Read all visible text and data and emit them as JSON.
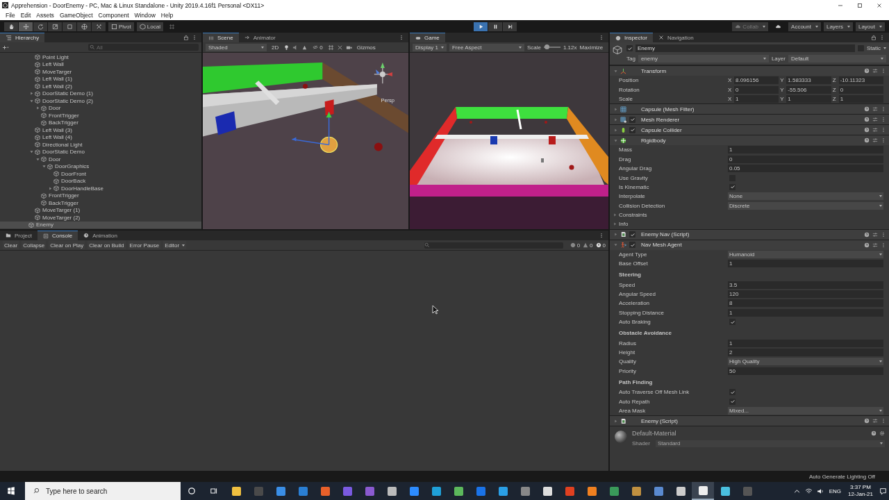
{
  "window": {
    "title": "Apprehension - DoorEnemy - PC, Mac & Linux Standalone - Unity 2019.4.16f1 Personal <DX11>"
  },
  "menu": [
    "File",
    "Edit",
    "Assets",
    "GameObject",
    "Component",
    "Window",
    "Help"
  ],
  "toolbar": {
    "tools": [
      {
        "kind": "hand",
        "selected": false
      },
      {
        "kind": "move",
        "selected": true
      },
      {
        "kind": "rotate",
        "selected": false
      },
      {
        "kind": "scale",
        "selected": false
      },
      {
        "kind": "rect",
        "selected": false
      },
      {
        "kind": "transform",
        "selected": false
      },
      {
        "kind": "custom",
        "selected": false
      }
    ],
    "pivot": "Pivot",
    "space": "Local",
    "play": [
      {
        "kind": "play",
        "selected": true
      },
      {
        "kind": "pause",
        "selected": false
      },
      {
        "kind": "step",
        "selected": false
      }
    ],
    "collab": "Collab",
    "account": "Account",
    "layers": "Layers",
    "layout": "Layout"
  },
  "hierarchy": {
    "tab": "Hierarchy",
    "search": {
      "placeholder": "All"
    },
    "tree": [
      {
        "children": [
          {
            "label": "Point Light",
            "selected": false
          },
          {
            "label": "Left Wall",
            "selected": false
          },
          {
            "label": "MoveTarger",
            "selected": false
          },
          {
            "label": "Left Wall (1)",
            "selected": false
          },
          {
            "label": "Left Wall (2)",
            "selected": false
          },
          {
            "label": "DoorStatic Demo (1)",
            "selected": false,
            "expanded": false
          },
          {
            "label": "DoorStatic Demo (2)",
            "selected": false,
            "expanded": true,
            "children": [
              {
                "label": "Door",
                "selected": false,
                "expanded": false
              },
              {
                "label": "FrontTrigger",
                "selected": false
              },
              {
                "label": "BackTrigger",
                "selected": false
              }
            ]
          },
          {
            "label": "Left Wall (3)",
            "selected": false
          },
          {
            "label": "Left Wall (4)",
            "selected": false
          },
          {
            "label": "Directional Light",
            "selected": false
          },
          {
            "label": "DoorStatic Demo",
            "selected": false,
            "expanded": true,
            "children": [
              {
                "label": "Door",
                "selected": false,
                "expanded": true,
                "children": [
                  {
                    "label": "DoorGraphics",
                    "selected": false,
                    "expanded": true,
                    "children": [
                      {
                        "label": "DoorFront",
                        "selected": false
                      },
                      {
                        "label": "DoorBack",
                        "selected": false
                      },
                      {
                        "label": "DoorHandleBase",
                        "selected": false,
                        "expanded": false
                      }
                    ]
                  }
                ]
              },
              {
                "label": "FrontTrigger",
                "selected": false
              },
              {
                "label": "BackTrigger",
                "selected": false
              }
            ]
          },
          {
            "label": "MoveTarger (1)",
            "selected": false
          },
          {
            "label": "MoveTarger (2)",
            "selected": false
          }
        ]
      },
      {
        "label": "Enemy",
        "selected": true
      }
    ]
  },
  "scene": {
    "tabs": [
      {
        "label": "Scene",
        "selected": true
      },
      {
        "label": "Animator",
        "selected": false
      }
    ],
    "shading": "Shaded",
    "mode_2d": "2D",
    "hidden_count": "0",
    "gizmos": "Gizmos",
    "projection": "Persp"
  },
  "game": {
    "tab": "Game",
    "display": "Display 1",
    "aspect": "Free Aspect",
    "scale_label": "Scale",
    "scale": {
      "level": 0.15
    },
    "scale_value": "1.12x",
    "maximize": "Maximize"
  },
  "console": {
    "tabs": [
      {
        "label": "Project",
        "kind": "folder",
        "selected": false
      },
      {
        "label": "Console",
        "kind": "console",
        "selected": true
      },
      {
        "label": "Animation",
        "kind": "clock",
        "selected": false
      }
    ],
    "buttons": [
      "Clear",
      "Collapse",
      "Clear on Play",
      "Clear on Build",
      "Error Pause"
    ],
    "editor": "Editor",
    "counts": [
      {
        "kind": "info",
        "count": "0"
      },
      {
        "kind": "warning",
        "count": "0"
      },
      {
        "kind": "error",
        "count": "0"
      }
    ]
  },
  "inspector": {
    "tabs": [
      {
        "label": "Inspector",
        "kind": "info",
        "selected": true
      },
      {
        "label": "Navigation",
        "kind": "nav",
        "selected": false
      }
    ],
    "object": {
      "active": true,
      "name": "Enemy",
      "static": false,
      "static_label": "Static",
      "tag_label": "Tag",
      "tag": "enemy",
      "layer_label": "Layer",
      "layer": "Default"
    },
    "components": [
      {
        "name": "Transform",
        "kind": "transform",
        "expanded": true,
        "properties": [
          {
            "kind": "vector",
            "label": "Position",
            "axes": [
              {
                "axis": "X",
                "value": "8.096156"
              },
              {
                "axis": "Y",
                "value": "1.583333"
              },
              {
                "axis": "Z",
                "value": "-10.11323"
              }
            ]
          },
          {
            "kind": "vector",
            "label": "Rotation",
            "axes": [
              {
                "axis": "X",
                "value": "0"
              },
              {
                "axis": "Y",
                "value": "-55.506"
              },
              {
                "axis": "Z",
                "value": "0"
              }
            ]
          },
          {
            "kind": "vector",
            "label": "Scale",
            "axes": [
              {
                "axis": "X",
                "value": "1"
              },
              {
                "axis": "Y",
                "value": "1"
              },
              {
                "axis": "Z",
                "value": "1"
              }
            ]
          }
        ]
      },
      {
        "name": "Capsule (Mesh Filter)",
        "kind": "mesh",
        "expanded": false
      },
      {
        "name": "Mesh Renderer",
        "kind": "renderer",
        "expanded": false,
        "enabled": true
      },
      {
        "name": "Capsule Collider",
        "kind": "capsule",
        "expanded": false,
        "enabled": true
      },
      {
        "name": "Rigidbody",
        "kind": "rigidbody",
        "expanded": true,
        "properties": [
          {
            "kind": "field",
            "label": "Mass",
            "value": "1"
          },
          {
            "kind": "field",
            "label": "Drag",
            "value": "0"
          },
          {
            "kind": "field",
            "label": "Angular Drag",
            "value": "0.05"
          },
          {
            "kind": "checkbox",
            "label": "Use Gravity",
            "checked": false
          },
          {
            "kind": "checkbox",
            "label": "Is Kinematic",
            "checked": true
          },
          {
            "kind": "dropdown",
            "label": "Interpolate",
            "value": "None"
          },
          {
            "kind": "dropdown",
            "label": "Collision Detection",
            "value": "Discrete"
          },
          {
            "kind": "foldout",
            "label": "Constraints",
            "expanded": false
          },
          {
            "kind": "foldout",
            "label": "Info",
            "expanded": false
          }
        ]
      },
      {
        "name": "Enemy Nav (Script)",
        "kind": "script",
        "expanded": false,
        "enabled": true
      },
      {
        "name": "Nav Mesh Agent",
        "kind": "agent",
        "expanded": true,
        "enabled": true,
        "properties": [
          {
            "kind": "dropdown",
            "label": "Agent Type",
            "value": "Humanoid"
          },
          {
            "kind": "field",
            "label": "Base Offset",
            "value": "1"
          },
          {
            "kind": "header",
            "label": "Steering"
          },
          {
            "kind": "field",
            "label": "Speed",
            "value": "3.5"
          },
          {
            "kind": "field",
            "label": "Angular Speed",
            "value": "120"
          },
          {
            "kind": "field",
            "label": "Acceleration",
            "value": "8"
          },
          {
            "kind": "field",
            "label": "Stopping Distance",
            "value": "1"
          },
          {
            "kind": "checkbox",
            "label": "Auto Braking",
            "checked": true
          },
          {
            "kind": "header",
            "label": "Obstacle Avoidance"
          },
          {
            "kind": "field",
            "label": "Radius",
            "value": "1"
          },
          {
            "kind": "field",
            "label": "Height",
            "value": "2"
          },
          {
            "kind": "dropdown",
            "label": "Quality",
            "value": "High Quality"
          },
          {
            "kind": "field",
            "label": "Priority",
            "value": "50"
          },
          {
            "kind": "header",
            "label": "Path Finding"
          },
          {
            "kind": "checkbox",
            "label": "Auto Traverse Off Mesh Link",
            "checked": true
          },
          {
            "kind": "checkbox",
            "label": "Auto Repath",
            "checked": true
          },
          {
            "kind": "dropdown",
            "label": "Area Mask",
            "value": "Mixed..."
          }
        ]
      },
      {
        "name": "Enemy (Script)",
        "kind": "script",
        "expanded": false
      }
    ],
    "material": {
      "name": "Default-Material",
      "shader_label": "Shader",
      "shader": "Standard"
    }
  },
  "status_bar": {
    "text": "Auto Generate Lighting Off"
  },
  "taskbar": {
    "search": {
      "placeholder": "Type here to search"
    },
    "apps": [
      {
        "color": "#f0c040",
        "selected": false
      },
      {
        "color": "#4a4a4a",
        "selected": false
      },
      {
        "color": "#3a8ee6",
        "selected": false
      },
      {
        "color": "#2a7fd4",
        "selected": false
      },
      {
        "color": "#e8602a",
        "selected": false
      },
      {
        "color": "#7a5ae0",
        "selected": false
      },
      {
        "color": "#8a5ad0",
        "selected": false
      },
      {
        "color": "#bbbbbb",
        "selected": false
      },
      {
        "color": "#2d8cff",
        "selected": false
      },
      {
        "color": "#1fa0d8",
        "selected": false
      },
      {
        "color": "#5cb85c",
        "selected": false
      },
      {
        "color": "#1a73e8",
        "selected": false
      },
      {
        "color": "#2a9fe6",
        "selected": false
      },
      {
        "color": "#888888",
        "selected": false
      },
      {
        "color": "#dddddd",
        "selected": false
      },
      {
        "color": "#e04020",
        "selected": false
      },
      {
        "color": "#f08020",
        "selected": false
      },
      {
        "color": "#3a9a5a",
        "selected": false
      },
      {
        "color": "#c09040",
        "selected": false
      },
      {
        "color": "#5a8ad0",
        "selected": false
      },
      {
        "color": "#cccccc",
        "selected": false
      },
      {
        "color": "#eeeeee",
        "selected": true
      },
      {
        "color": "#4ac0e0",
        "selected": false
      },
      {
        "color": "#555555",
        "selected": false
      }
    ],
    "language": "ENG",
    "time": "3:37 PM",
    "date": "12-Jan-21"
  }
}
